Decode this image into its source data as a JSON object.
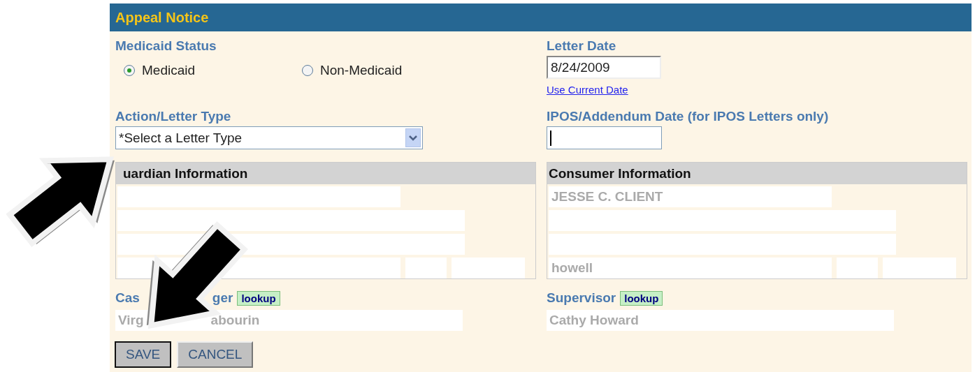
{
  "header": {
    "title": "Appeal Notice"
  },
  "medicaid_status": {
    "label": "Medicaid Status",
    "options": [
      {
        "label": "Medicaid",
        "selected": true
      },
      {
        "label": "Non-Medicaid",
        "selected": false
      }
    ]
  },
  "letter_date": {
    "label": "Letter Date",
    "value": "8/24/2009",
    "link": "Use Current Date"
  },
  "letter_type": {
    "label": "Action/Letter Type",
    "value": "*Select a Letter Type"
  },
  "ipos_date": {
    "label": "IPOS/Addendum Date (for IPOS Letters only)"
  },
  "guardian_information": {
    "title": "uardian Information"
  },
  "consumer_information": {
    "title": "Consumer Information",
    "field_1": "JESSE C. CLIENT",
    "field_4": "howell"
  },
  "case_manager": {
    "label_parts": [
      "Cas",
      "ger"
    ],
    "lookup": "lookup",
    "value_parts": [
      "Virg",
      "abourin"
    ]
  },
  "supervisor": {
    "label": "Supervisor",
    "lookup": "lookup",
    "value": "Cathy Howard"
  },
  "buttons": [
    {
      "label": "SAVE",
      "focused": true
    },
    {
      "label": "CANCEL",
      "focused": false
    }
  ]
}
